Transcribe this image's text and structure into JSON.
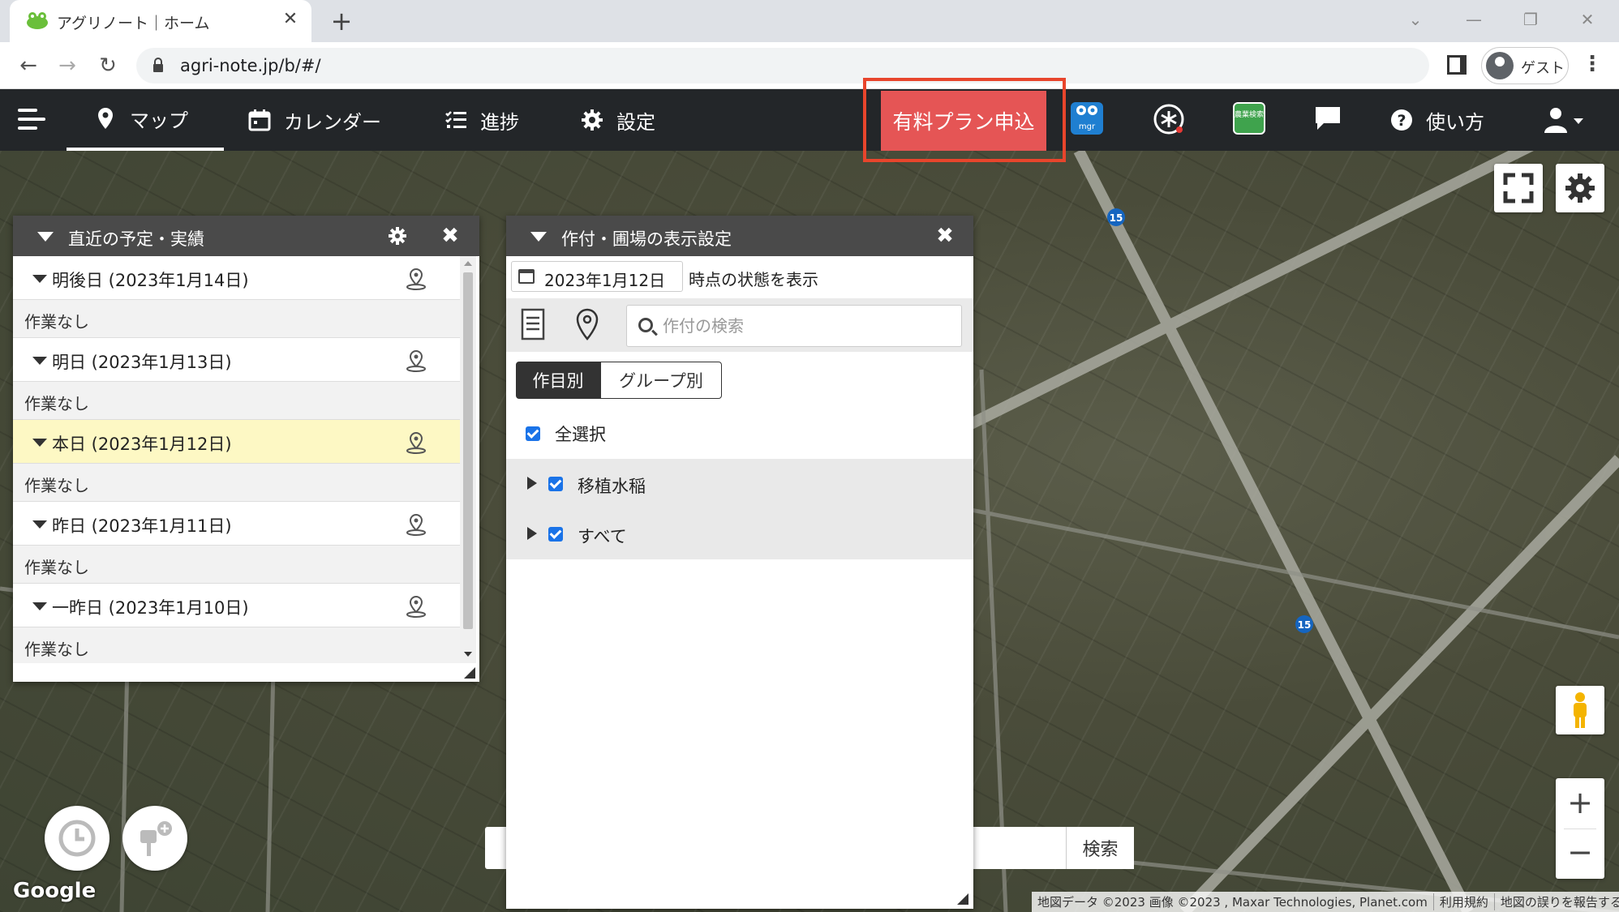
{
  "browser": {
    "tab_title": "アグリノート｜ホーム",
    "url": "agri-note.jp/b/#/",
    "profile_label": "ゲスト"
  },
  "nav": {
    "map": "マップ",
    "calendar": "カレンダー",
    "progress": "進捗",
    "settings": "設定",
    "plan_button": "有料プラン申込",
    "help": "使い方",
    "mgr_icon_text": "mgr",
    "book_icon_text": "農業検索"
  },
  "schedule_panel": {
    "title": "直近の予定・実績",
    "days": [
      {
        "label": "明後日 (2023年1月14日)",
        "empty": "作業なし",
        "today": false
      },
      {
        "label": "明日 (2023年1月13日)",
        "empty": "作業なし",
        "today": false
      },
      {
        "label": "本日 (2023年1月12日)",
        "empty": "作業なし",
        "today": true
      },
      {
        "label": "昨日 (2023年1月11日)",
        "empty": "作業なし",
        "today": false
      },
      {
        "label": "一昨日 (2023年1月10日)",
        "empty": "作業なし",
        "today": false
      }
    ]
  },
  "crop_panel": {
    "title": "作付・圃場の表示設定",
    "date_value": "2023年1月12日",
    "date_suffix": "時点の状態を表示",
    "search_placeholder": "作付の検索",
    "seg_by_crop": "作目別",
    "seg_by_group": "グループ別",
    "select_all": "全選択",
    "groups": [
      "移植水稲",
      "すべて"
    ]
  },
  "map": {
    "search_button": "検索",
    "road_badge": "15",
    "google": "Google",
    "attribution": [
      "地図データ ©2023 画像 ©2023 , Maxar Technologies, Planet.com",
      "利用規約",
      "地図の誤りを報告する"
    ]
  },
  "colors": {
    "plan_button": "#e55555",
    "highlight_box": "#e8452c",
    "nav_bg": "#232629",
    "checkbox": "#1a73e8",
    "today_row": "#fdf8c4"
  }
}
